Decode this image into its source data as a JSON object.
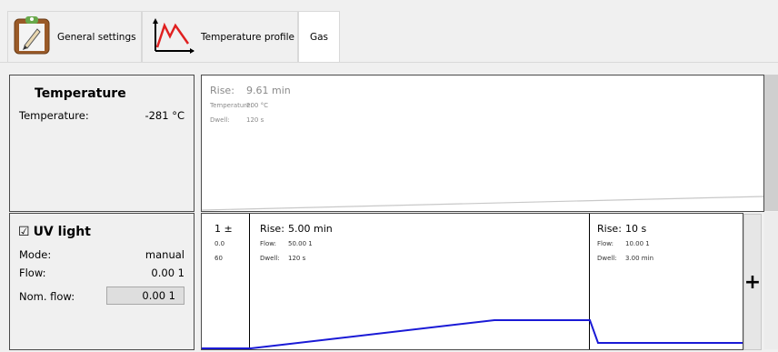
{
  "tabs": [
    {
      "label": "General settings"
    },
    {
      "label": "Temperature profile"
    },
    {
      "label": "Gas"
    }
  ],
  "temperature_panel": {
    "title": "Temperature",
    "label": "Temperature:",
    "value": "-281 °C"
  },
  "temperature_plot": {
    "rise_label": "Rise:",
    "rise_value": "9.61 min",
    "temp_label": "Temperature:",
    "temp_value": "200 °C",
    "dwell_label": "Dwell:",
    "dwell_value": "120 s"
  },
  "uv_panel": {
    "checkbox": "☑",
    "title": "UV light",
    "mode_label": "Mode:",
    "mode_value": "manual",
    "flow_label": "Flow:",
    "flow_value": "0.00 1",
    "nom_flow_label": "Nom. flow:",
    "nom_flow_value": "0.00 1"
  },
  "uv_plot": {
    "seg1": {
      "rise": "1 ±",
      "flow": "0.0",
      "dwell": "60"
    },
    "seg2": {
      "rise_label": "Rise:",
      "rise_value": "5.00 min",
      "flow_label": "Flow:",
      "flow_value": "50.00 1",
      "dwell_label": "Dwell:",
      "dwell_value": "120 s"
    },
    "seg3": {
      "rise_label": "Rise:",
      "rise_value": "10 s",
      "flow_label": "Flow:",
      "flow_value": "10.00 1",
      "dwell_label": "Dwell:",
      "dwell_value": "3.00 min"
    }
  },
  "add_button": "+",
  "colors": {
    "line": "#1a1ad6",
    "tab_active": "#ffffff"
  }
}
